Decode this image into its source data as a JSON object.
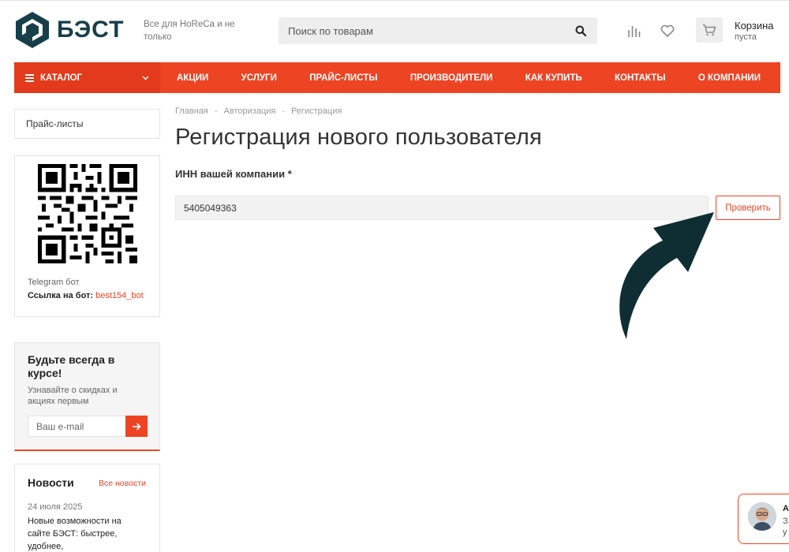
{
  "header": {
    "logo_text": "БЭСТ",
    "tagline": "Все для HoReCa и не только",
    "search_placeholder": "Поиск по товарам",
    "cart_title": "Корзина",
    "cart_subtitle": "пуста",
    "icons": [
      "compare-icon",
      "favorite-icon",
      "cart-icon",
      "search-icon"
    ]
  },
  "nav": {
    "catalog_label": "КАТАЛОГ",
    "items": [
      "АКЦИИ",
      "УСЛУГИ",
      "ПРАЙС-ЛИСТЫ",
      "ПРОИЗВОДИТЕЛИ",
      "КАК КУПИТЬ",
      "КОНТАКТЫ",
      "О КОМПАНИИ"
    ]
  },
  "sidebar": {
    "pricelists_label": "Прайс-листы",
    "telegram_title": "Telegram бот",
    "telegram_link_label": "Ссылка на бот:",
    "telegram_link": "best154_bot",
    "subscribe_title": "Будьте всегда в курсе!",
    "subscribe_text": "Узнавайте о скидках и акциях первым",
    "subscribe_placeholder": "Ваш e-mail",
    "news_title": "Новости",
    "news_all": "Все новости",
    "news_date": "24 июля 2025",
    "news_text": "Новые возможности на сайте БЭСТ: быстрее, удобнее,"
  },
  "main": {
    "breadcrumb": [
      "Главная",
      "Авторизация",
      "Регистрация"
    ],
    "breadcrumb_sep": "-",
    "title": "Регистрация нового пользователя",
    "inn_label": "ИНН вашей компании *",
    "inn_value": "5405049363",
    "check_button": "Проверить"
  },
  "chat": {
    "name_initial": "А",
    "line1": "З,",
    "line2": "у"
  },
  "colors": {
    "accent": "#ed4424",
    "brand_dark": "#173f4a",
    "arrow": "#0f2e33"
  }
}
